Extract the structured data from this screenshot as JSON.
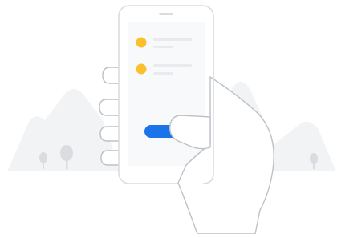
{
  "illustration": {
    "colors": {
      "background": "#ffffff",
      "mountain": "#f1f3f4",
      "tree": "#dadce0",
      "phone_body": "#ffffff",
      "phone_outline": "#dadce0",
      "phone_screen": "#f8f9fa",
      "speaker": "#dadce0",
      "list_dot": "#fbc02d",
      "list_line": "#e8eaed",
      "button": "#1a73e8",
      "hand_outline": "#bdc1c6"
    },
    "list_items": [
      {
        "icon": "yellow-dot-icon"
      },
      {
        "icon": "yellow-dot-icon"
      }
    ],
    "button_color_role": "primary-blue"
  }
}
